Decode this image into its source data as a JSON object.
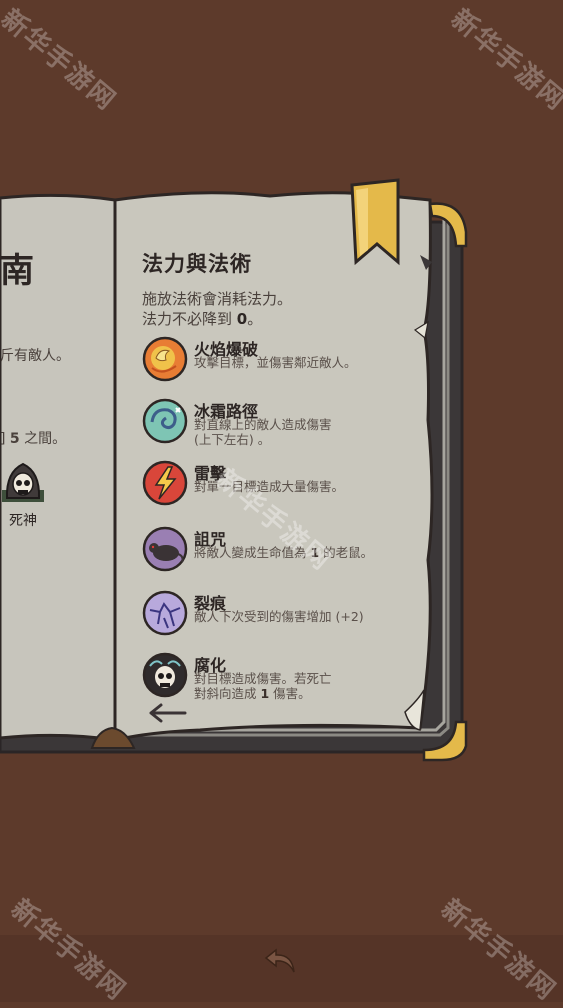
{
  "watermark": "新华手游网",
  "left_page": {
    "title": "南",
    "line1": "斤有敵人。",
    "line2_prefix": "] ",
    "line2_num": "5",
    "line2_suffix": " 之間。",
    "icon": "reaper-skull-icon",
    "icon_label": "死神"
  },
  "right_page": {
    "title": "法力與法術",
    "intro1": "施放法術會消耗法力。",
    "intro2_prefix": "法力不必降到 ",
    "intro2_num": "0",
    "intro2_suffix": "。",
    "spells": [
      {
        "name": "火焰爆破",
        "desc": "攻擊目標，並傷害鄰近敵人。",
        "icon": "fire-blast-icon"
      },
      {
        "name": "冰霜路徑",
        "desc": "對直線上的敵人造成傷害",
        "desc2": "(上下左右) 。",
        "icon": "frost-path-icon"
      },
      {
        "name": "雷擊",
        "desc": "對單一目標造成大量傷害。",
        "icon": "lightning-icon"
      },
      {
        "name": "詛咒",
        "desc_prefix": "將敵人變成生命值為 ",
        "desc_num": "1",
        "desc_suffix": " 的老鼠。",
        "icon": "curse-rat-icon"
      },
      {
        "name": "裂痕",
        "desc": "敵人下次受到的傷害增加 (+2)",
        "icon": "crack-icon"
      },
      {
        "name": "腐化",
        "desc": "對目標造成傷害。若死亡",
        "desc2_prefix": "對斜向造成 ",
        "desc2_num": "1",
        "desc2_suffix": " 傷害。",
        "icon": "corruption-skull-icon"
      }
    ]
  },
  "colors": {
    "background": "#5d3a2b",
    "page": "#c5c4bb",
    "cover": "#3f3c3d",
    "bookmark": "#e4b94a"
  }
}
